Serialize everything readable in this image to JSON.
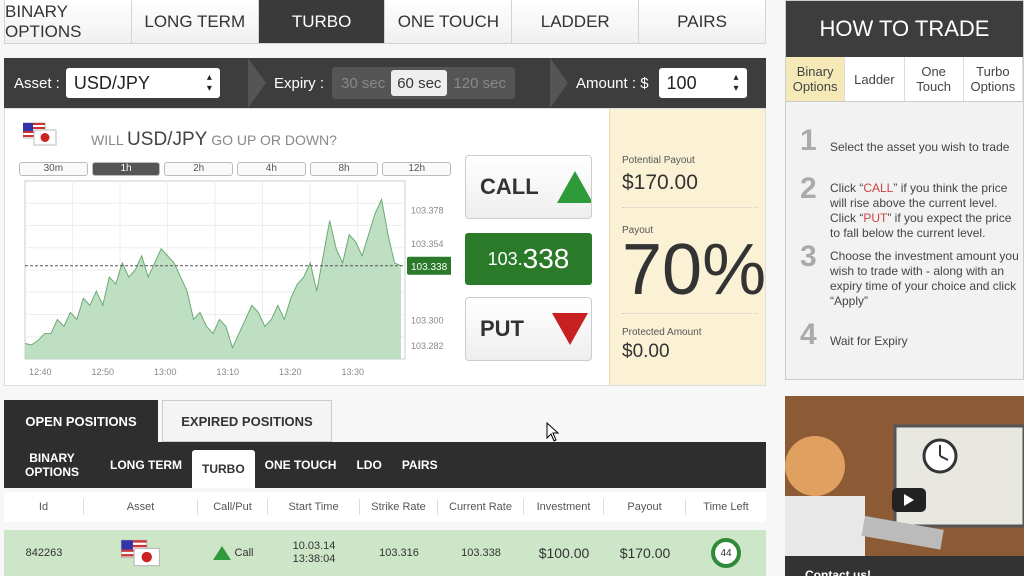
{
  "tabs": [
    "BINARY OPTIONS",
    "LONG TERM",
    "TURBO",
    "ONE TOUCH",
    "LADDER",
    "PAIRS"
  ],
  "config": {
    "asset_label": "Asset :",
    "asset_value": "USD/JPY",
    "expiry_label": "Expiry :",
    "expiry_opts": [
      "30 sec",
      "60 sec",
      "120 sec"
    ],
    "amount_label": "Amount : $",
    "amount_value": "100"
  },
  "question": {
    "pre": "WILL",
    "asset": "USD/JPY",
    "post": "GO UP OR DOWN?"
  },
  "ranges": [
    "30m",
    "1h",
    "2h",
    "4h",
    "8h",
    "12h"
  ],
  "call_label": "CALL",
  "put_label": "PUT",
  "rate": {
    "prefix": "103.",
    "main": "338"
  },
  "chart_data": {
    "type": "area",
    "x": [
      "12:40",
      "12:50",
      "13:00",
      "13:10",
      "13:20",
      "13:30"
    ],
    "yticks": [
      "103.378",
      "103.354",
      "103.300",
      "103.282"
    ],
    "ylim": [
      103.272,
      103.398
    ],
    "current": "103.338",
    "values": [
      103.283,
      103.282,
      103.285,
      103.29,
      103.29,
      103.3,
      103.295,
      103.305,
      103.3,
      103.315,
      103.31,
      103.32,
      103.31,
      103.33,
      103.325,
      103.34,
      103.33,
      103.335,
      103.345,
      103.33,
      103.34,
      103.35,
      103.345,
      103.34,
      103.33,
      103.32,
      103.3,
      103.305,
      103.295,
      103.29,
      103.3,
      103.295,
      103.28,
      103.29,
      103.3,
      103.31,
      103.305,
      103.295,
      103.3,
      103.31,
      103.3,
      103.315,
      103.325,
      103.33,
      103.34,
      103.32,
      103.345,
      103.37,
      103.35,
      103.34,
      103.36,
      103.355,
      103.345,
      103.36,
      103.375,
      103.385,
      103.36,
      103.34,
      103.338
    ]
  },
  "payout": {
    "potential_label": "Potential Payout",
    "potential_value": "$170.00",
    "payout_label": "Payout",
    "payout_value": "70%",
    "protected_label": "Protected Amount",
    "protected_value": "$0.00"
  },
  "howto": {
    "title": "HOW TO TRADE",
    "tabs": [
      "Binary Options",
      "Ladder",
      "One Touch",
      "Turbo Options"
    ],
    "steps": [
      {
        "n": "1",
        "text": "Select the asset you wish to trade"
      },
      {
        "n": "2",
        "a": "Click “",
        "call": "CALL",
        "b": "” if you think the price will rise above the current level. Click “",
        "put": "PUT",
        "c": "” if you expect the price to fall below the current level."
      },
      {
        "n": "3",
        "text": "Choose the investment amount you wish to trade with - along with an expiry time of your choice and click “Apply”"
      },
      {
        "n": "4",
        "text": "Wait for Expiry"
      }
    ]
  },
  "positions": {
    "open": "OPEN POSITIONS",
    "expired": "EXPIRED POSITIONS"
  },
  "subtabs": [
    "BINARY OPTIONS",
    "LONG TERM",
    "TURBO",
    "ONE TOUCH",
    "LDO",
    "PAIRS"
  ],
  "table": {
    "headers": [
      "Id",
      "Asset",
      "Call/Put",
      "Start Time",
      "Strike Rate",
      "Current Rate",
      "Investment",
      "Payout",
      "Time Left"
    ],
    "row": {
      "id": "842263",
      "type": "Call",
      "date": "10.03.14",
      "time": "13:38:04",
      "strike": "103.316",
      "current": "103.338",
      "investment": "$100.00",
      "payout": "$170.00",
      "left": "44"
    }
  },
  "video_caption": "Contact us!",
  "colors": {
    "green": "#2a7a2a",
    "red": "#c62020",
    "accent": "#f6e9b8"
  }
}
